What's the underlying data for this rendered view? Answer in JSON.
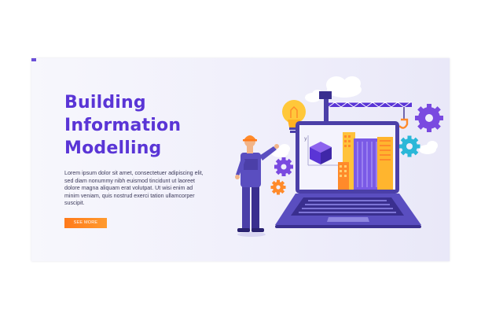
{
  "hero": {
    "title_lines": [
      "Building",
      "Information",
      "Modelling"
    ],
    "body": "Lorem ipsum dolor sit amet, consectetuer adipiscing elit, sed diam nonummy nibh euismod tincidunt ut laoreet dolore magna aliquam erat volutpat. Ut wisi enim ad minim veniam, quis nostrud exerci tation ullamcorper suscipit.",
    "cta_label": "SEE MORE"
  },
  "colors": {
    "accent": "#5a35d6",
    "cta": "#ff7a1a",
    "laptop": "#4b3fa8",
    "gear_teal": "#2ab7d8",
    "gear_purple": "#7a4ae0",
    "gear_orange": "#ff8a2a",
    "bulb": "#ffc83a",
    "building_yellow": "#ffc23a",
    "building_orange": "#ff8a2a",
    "building_purple": "#7a5ae6"
  },
  "illustration": {
    "screen_axis_labels": [
      "y",
      "x"
    ],
    "icons": [
      "light-bulb-icon",
      "crane-icon",
      "gear-icon",
      "cube-icon",
      "cloud-icon",
      "building-icon",
      "worker-icon",
      "laptop-icon"
    ]
  }
}
